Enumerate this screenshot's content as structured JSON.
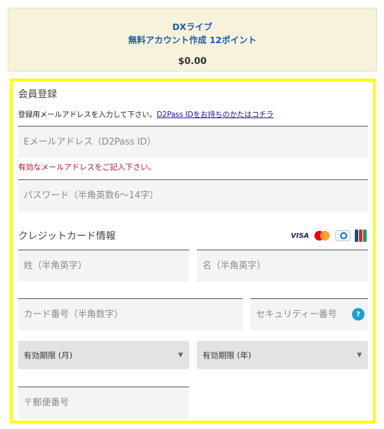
{
  "summary": {
    "line1": "DXライブ",
    "line2": "無料アカウント作成 12ポイント",
    "price": "$0.00"
  },
  "registration": {
    "title": "会員登録",
    "hint_text": "登録用メールアドレスを入力して下さい。",
    "hint_link": "D2Pass IDをお持ちのかたはコチラ",
    "email_placeholder": "Eメールアドレス（D2Pass ID）",
    "email_error": "有効なメールアドレスをご記入下さい。",
    "password_placeholder": "パスワード（半角英数6～14字）"
  },
  "credit_card": {
    "title": "クレジットカード情報",
    "logos": [
      "VISA",
      "MasterCard",
      "Diners Club",
      "JCB"
    ],
    "logo_icons": [
      "visa-logo-icon",
      "mastercard-logo-icon",
      "diners-club-logo-icon",
      "jcb-logo-icon"
    ],
    "last_name_placeholder": "姓（半角英字）",
    "first_name_placeholder": "名（半角英字）",
    "card_number_placeholder": "カード番号（半角数字）",
    "security_code_placeholder": "セキュリティー番号",
    "help_icon": "?",
    "expiry_month": "有効期限 (月)",
    "expiry_year": "有効期限 (年)",
    "postal_code_placeholder": "〒郵便番号"
  },
  "colors": {
    "panel_border": "#ffff00",
    "summary_bg": "#f7f2dc",
    "link": "#1a0dab",
    "title_blue": "#1a5ea8",
    "error": "#b3122d",
    "help_icon": "#1aa0d6"
  }
}
